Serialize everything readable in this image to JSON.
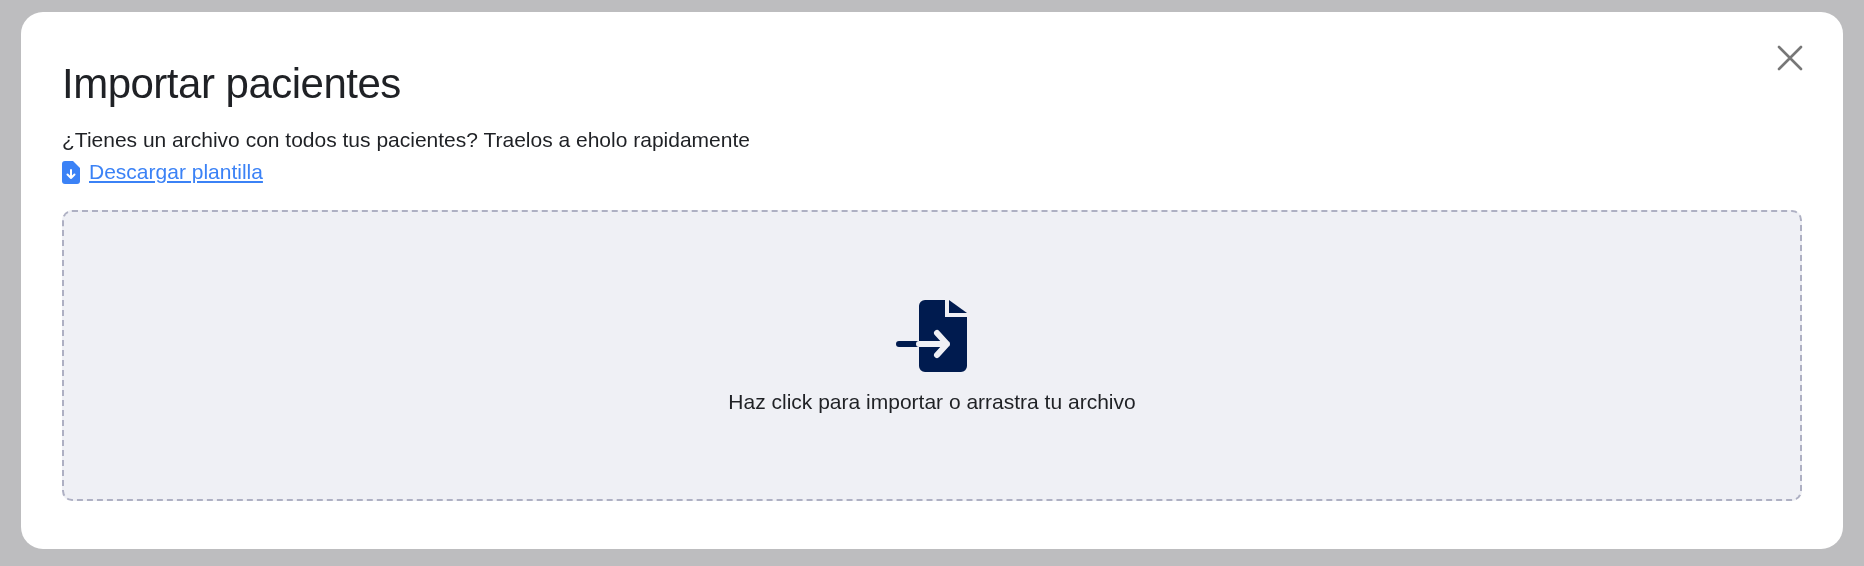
{
  "dialog": {
    "title": "Importar pacientes",
    "description": "¿Tienes un archivo con todos tus pacientes? Traelos a eholo rapidamente",
    "download_link": "Descargar plantilla",
    "dropzone": {
      "text": "Haz click para importar o arrastra tu archivo"
    }
  }
}
